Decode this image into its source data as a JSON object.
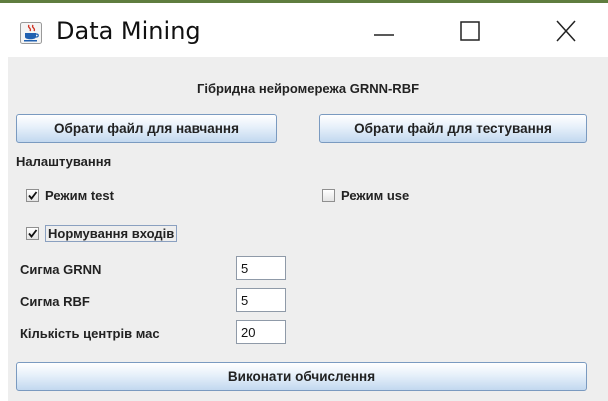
{
  "window": {
    "title": "Data Mining",
    "app_icon": "java-cup-icon",
    "controls": [
      "minimize-icon",
      "maximize-icon",
      "close-icon"
    ]
  },
  "main": {
    "heading": "Гібридна нейромережа GRNN-RBF",
    "train_button": "Обрати файл для навчання",
    "test_button": "Обрати файл для тестування",
    "settings_label": "Налаштування",
    "options": {
      "test_mode": {
        "label": "Режим test",
        "checked": true
      },
      "use_mode": {
        "label": "Режим use",
        "checked": false
      },
      "normalize_inputs": {
        "label": "Нормування входів",
        "checked": true
      }
    },
    "fields": {
      "sigma_grnn": {
        "label": "Сигма GRNN",
        "value": "5"
      },
      "sigma_rbf": {
        "label": "Сигма RBF",
        "value": "5"
      },
      "centers_count": {
        "label": "Кількість центрів мас",
        "value": "20"
      }
    },
    "run_button": "Виконати обчислення"
  },
  "colors": {
    "accent_line": "#5f7d3f",
    "button_border": "#7a9ac0",
    "panel_background": "#eeeeee"
  }
}
